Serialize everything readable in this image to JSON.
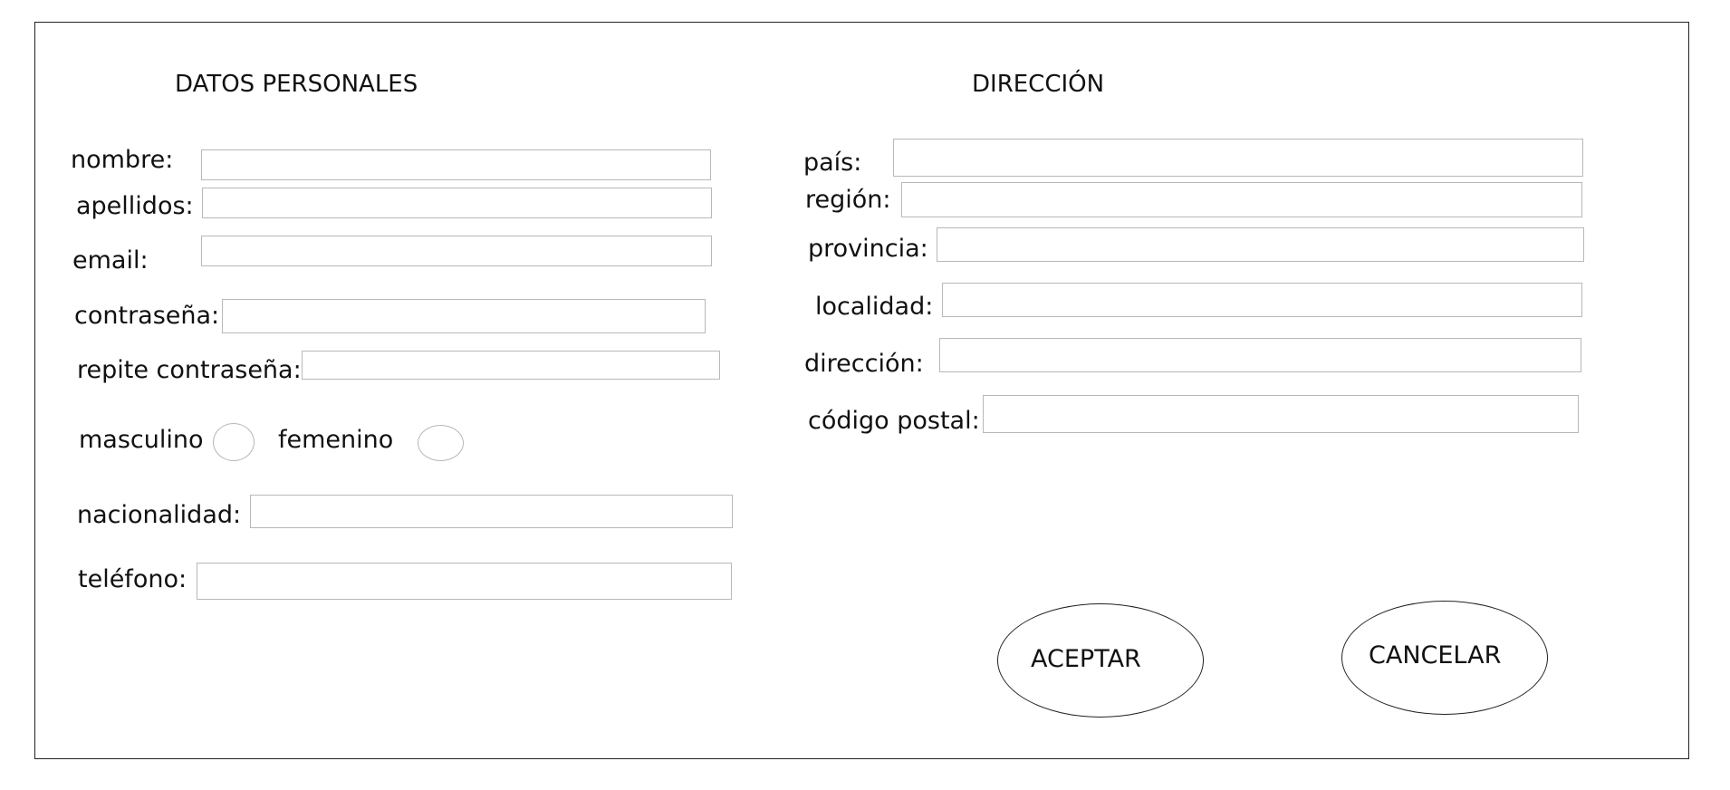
{
  "personal": {
    "heading": "DATOS PERSONALES",
    "nombre_label": "nombre:",
    "apellidos_label": "apellidos:",
    "email_label": "email:",
    "contrasena_label": "contraseña:",
    "repite_label": "repite contraseña:",
    "masculino_label": "masculino",
    "femenino_label": "femenino",
    "nacionalidad_label": "nacionalidad:",
    "telefono_label": "teléfono:"
  },
  "address": {
    "heading": "DIRECCIÓN",
    "pais_label": "país:",
    "region_label": "región:",
    "provincia_label": "provincia:",
    "localidad_label": "localidad:",
    "direccion_label": "dirección:",
    "postal_label": "código postal:"
  },
  "actions": {
    "accept_label": "ACEPTAR",
    "cancel_label": "CANCELAR"
  }
}
